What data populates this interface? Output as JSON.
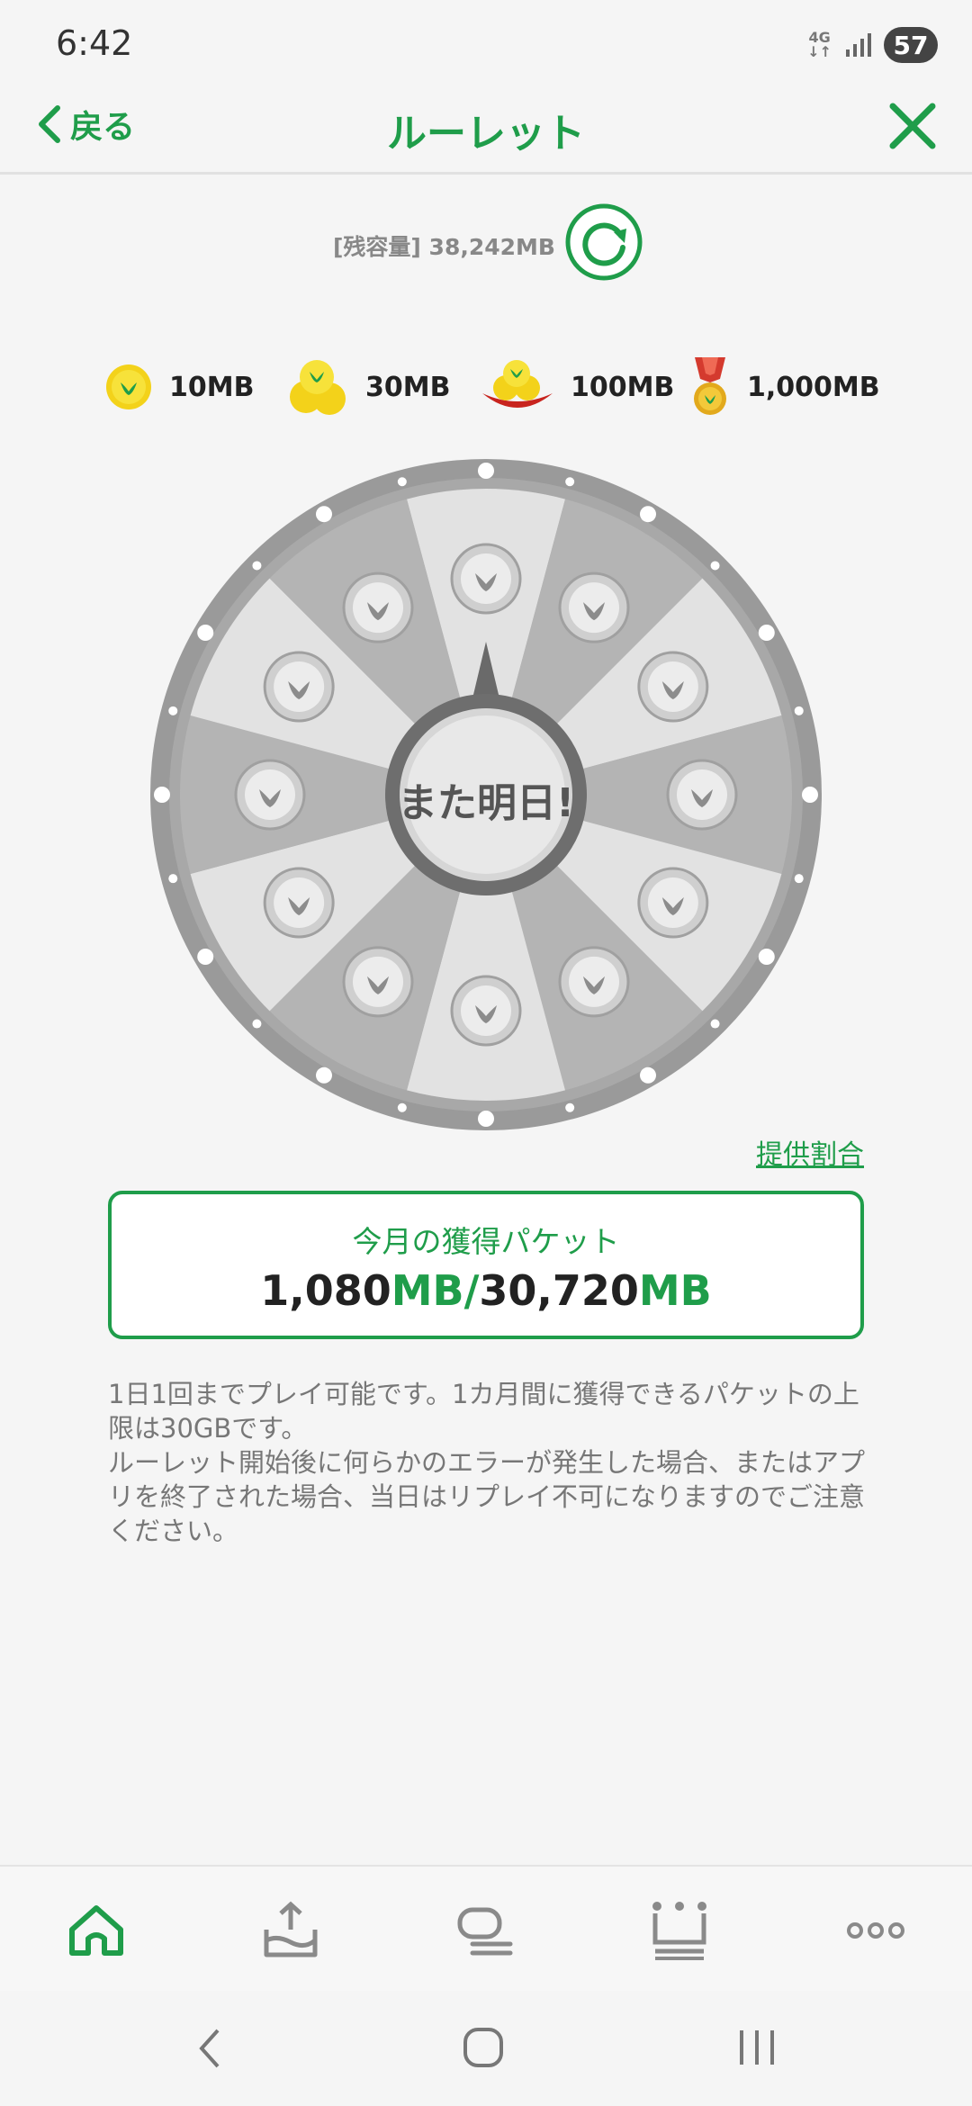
{
  "status": {
    "time": "6:42",
    "network": "4G",
    "battery": "57"
  },
  "header": {
    "back_label": "戻る",
    "title": "ルーレット"
  },
  "remaining": {
    "text": "[残容量] 38,242MB"
  },
  "legend": [
    {
      "icon": "single-coin-icon",
      "label": "10MB"
    },
    {
      "icon": "coin-pile-icon",
      "label": "30MB"
    },
    {
      "icon": "coin-tray-icon",
      "label": "100MB"
    },
    {
      "icon": "medal-icon",
      "label": "1,000MB"
    }
  ],
  "roulette": {
    "center_text": "また明日!"
  },
  "odds_link": "提供割合",
  "packet": {
    "title": "今月の獲得パケット",
    "earned_value": "1,080",
    "earned_unit": "MB/",
    "limit_value": "30,720",
    "limit_unit": "MB"
  },
  "notice": {
    "line1": "1日1回までプレイ可能です。1カ月間に獲得できるパケットの上限は30GBです。",
    "line2": "ルーレット開始後に何らかのエラーが発生した場合、またはアプリを終了された場合、当日はリプレイ不可になりますのでご注意ください。"
  },
  "bottom_nav": [
    {
      "icon": "home-icon",
      "active": true
    },
    {
      "icon": "data-share-icon",
      "active": false
    },
    {
      "icon": "chat-bubble-icon",
      "active": false
    },
    {
      "icon": "crown-icon",
      "active": false
    },
    {
      "icon": "more-dots-icon",
      "active": false
    }
  ],
  "colors": {
    "accent": "#1f9d4a",
    "background": "#f5f5f5"
  }
}
